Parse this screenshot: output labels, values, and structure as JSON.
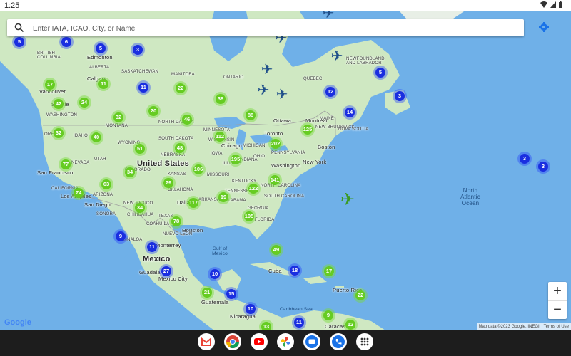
{
  "status_bar": {
    "time": "1:25"
  },
  "search": {
    "placeholder": "Enter IATA, ICAO, City, or Name"
  },
  "map": {
    "countries": [
      "United States",
      "Mexico"
    ],
    "ocean": "North Atlantic Ocean",
    "gulf": "Gulf of Mexico",
    "caribbean": "Caribbean Sea",
    "cities": [
      "Edmonton",
      "Calgary",
      "Vancouver",
      "Seattle",
      "San Francisco",
      "Los Angeles",
      "San Diego",
      "Monterrey",
      "Houston",
      "Dallas",
      "Chicago",
      "Toronto",
      "Ottawa",
      "Montreal",
      "Boston",
      "New York",
      "Washington",
      "Cuba",
      "Guadalajara",
      "Mexico City",
      "Guatemala",
      "Nicaragua",
      "Caracas",
      "Puerto Rico"
    ],
    "regions": [
      "ALBERTA",
      "SASKATCHEWAN",
      "MANITOBA",
      "ONTARIO",
      "QUEBEC",
      "NEWFOUNDLAND AND LABRADOR",
      "BRITISH COLUMBIA",
      "WASHINGTON",
      "OREGON",
      "IDAHO",
      "MONTANA",
      "WYOMING",
      "NEVADA",
      "UTAH",
      "COLORADO",
      "CALIFORNIA",
      "ARIZONA",
      "NEW MEXICO",
      "TEXAS",
      "OKLAHOMA",
      "KANSAS",
      "NEBRASKA",
      "SOUTH DAKOTA",
      "NORTH DAKOTA",
      "MINNESOTA",
      "WISCONSIN",
      "MICHIGAN",
      "IOWA",
      "MISSOURI",
      "ILLINOIS",
      "INDIANA",
      "OHIO",
      "KENTUCKY",
      "TENNESSEE",
      "GEORGIA",
      "NORTH CAROLINA",
      "SOUTH CAROLINA",
      "PENNSYLVANIA",
      "NEW BRUNSWICK",
      "NOVA SCOTIA",
      "ARKANSAS",
      "ALABAMA",
      "FLORIDA",
      "MAINE",
      "SINALOA",
      "NUEVO LEON",
      "CHIHUAHUA",
      "SONORA",
      "COAHUILA"
    ],
    "clusters": [
      {
        "value": "5",
        "color": "blue"
      },
      {
        "value": "6",
        "color": "blue"
      },
      {
        "value": "5",
        "color": "blue"
      },
      {
        "value": "3",
        "color": "blue"
      },
      {
        "value": "11",
        "color": "green"
      },
      {
        "value": "11",
        "color": "blue"
      },
      {
        "value": "22",
        "color": "green"
      },
      {
        "value": "17",
        "color": "green"
      },
      {
        "value": "42",
        "color": "green"
      },
      {
        "value": "24",
        "color": "green"
      },
      {
        "value": "32",
        "color": "green"
      },
      {
        "value": "20",
        "color": "green"
      },
      {
        "value": "46",
        "color": "green"
      },
      {
        "value": "38",
        "color": "green"
      },
      {
        "value": "88",
        "color": "green"
      },
      {
        "value": "12",
        "color": "blue"
      },
      {
        "value": "3",
        "color": "blue"
      },
      {
        "value": "14",
        "color": "blue"
      },
      {
        "value": "5",
        "color": "blue"
      },
      {
        "value": "32",
        "color": "green"
      },
      {
        "value": "40",
        "color": "green"
      },
      {
        "value": "51",
        "color": "green"
      },
      {
        "value": "48",
        "color": "green"
      },
      {
        "value": "112",
        "color": "green"
      },
      {
        "value": "125",
        "color": "green"
      },
      {
        "value": "202",
        "color": "green"
      },
      {
        "value": "77",
        "color": "green"
      },
      {
        "value": "34",
        "color": "green"
      },
      {
        "value": "195",
        "color": "green"
      },
      {
        "value": "106",
        "color": "green"
      },
      {
        "value": "63",
        "color": "green"
      },
      {
        "value": "79",
        "color": "green"
      },
      {
        "value": "74",
        "color": "green"
      },
      {
        "value": "19",
        "color": "green"
      },
      {
        "value": "122",
        "color": "green"
      },
      {
        "value": "141",
        "color": "green"
      },
      {
        "value": "117",
        "color": "green"
      },
      {
        "value": "34",
        "color": "green"
      },
      {
        "value": "78",
        "color": "green"
      },
      {
        "value": "105",
        "color": "green"
      },
      {
        "value": "9",
        "color": "blue"
      },
      {
        "value": "11",
        "color": "blue"
      },
      {
        "value": "49",
        "color": "green"
      },
      {
        "value": "27",
        "color": "blue"
      },
      {
        "value": "10",
        "color": "blue"
      },
      {
        "value": "18",
        "color": "blue"
      },
      {
        "value": "17",
        "color": "green"
      },
      {
        "value": "21",
        "color": "green"
      },
      {
        "value": "15",
        "color": "blue"
      },
      {
        "value": "22",
        "color": "green"
      },
      {
        "value": "10",
        "color": "blue"
      },
      {
        "value": "9",
        "color": "green"
      },
      {
        "value": "12",
        "color": "green"
      },
      {
        "value": "13",
        "color": "green"
      },
      {
        "value": "11",
        "color": "blue"
      },
      {
        "value": "3",
        "color": "blue"
      },
      {
        "value": "3",
        "color": "blue"
      }
    ]
  },
  "zoom": {
    "in_label": "+",
    "out_label": "−"
  },
  "google_logo": "Google",
  "attribution": {
    "map_data": "Map data ©2023 Google, INEGI",
    "terms": "Terms of Use"
  },
  "dock": [
    "gmail-icon",
    "chrome-icon",
    "youtube-icon",
    "photos-icon",
    "messages-icon",
    "phone-icon",
    "apps-icon"
  ],
  "colors": {
    "water": "#6fb0e8",
    "land": "#cfe8c2",
    "cluster_green": "#66cc22",
    "cluster_blue": "#1a2ee0",
    "accent": "#1a73e8"
  }
}
